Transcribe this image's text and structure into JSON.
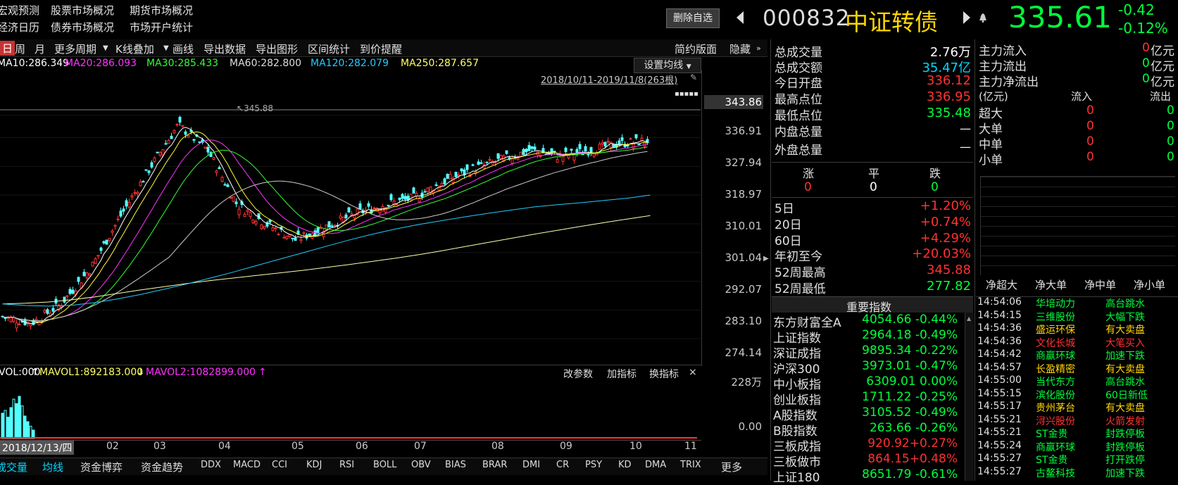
{
  "topnav": {
    "row1": [
      "宏观预测",
      "股票市场概况",
      "期货市场概况"
    ],
    "row2": [
      "经济日历",
      "债券市场概况",
      "市场开户统计"
    ]
  },
  "header": {
    "delete_button": "删除自选",
    "code": "000832",
    "name": "中证转债",
    "price": "335.61",
    "change": "-0.42",
    "change_pct": "-0.12%"
  },
  "toolbar": {
    "items": [
      "日",
      "周",
      "月",
      "更多周期",
      "K线叠加",
      "画线",
      "导出数据",
      "导出图形",
      "区间统计",
      "到价提醒"
    ],
    "simple_layout": "简约版面",
    "hide": "隐藏"
  },
  "ma_legend": {
    "ma10": "MA10:286.349",
    "ma20": "MA20:286.093",
    "ma30": "MA30:285.433",
    "ma60": "MA60:282.800",
    "ma120": "MA120:282.079",
    "ma250": "MA250:287.657",
    "set_ma": "设置均线",
    "date_range": "2018/10/11-2019/11/8(263根)"
  },
  "chart_data": {
    "type": "candlestick",
    "y_ticks": [
      "343.86",
      "336.91",
      "327.94",
      "318.97",
      "310.01",
      "301.04",
      "292.07",
      "283.10",
      "274.14"
    ],
    "ylim": [
      270,
      350
    ],
    "x_ticks": [
      "2018/12/13/四",
      "02",
      "03",
      "04",
      "05",
      "06",
      "07",
      "08",
      "09",
      "10",
      "11"
    ],
    "high_marker": "345.88",
    "volume_legend": {
      "vol": "VOL:000",
      "mavol1": "MAVOL1:892183.000",
      "mavol2": "MAVOL2:1082899.000"
    },
    "volume_y_ticks": [
      "228万",
      "0.00"
    ],
    "series": [
      {
        "name": "MA250",
        "values": [
          285,
          285.2,
          285.6,
          286.3,
          287.2,
          288.3,
          289.4,
          290.4,
          291.4,
          292.3,
          293.1,
          293.9,
          294.7,
          295.5,
          296.4,
          297.3,
          298.3,
          299.3,
          300.4,
          301.6,
          302.9,
          304.2,
          305.5,
          306.8,
          308.0,
          309.2,
          310.4,
          311.5,
          312.6
        ]
      },
      {
        "name": "MA120",
        "values": [
          285,
          284.5,
          284.3,
          284.6,
          285.4,
          286.6,
          288.0,
          289.6,
          291.3,
          293.1,
          295.0,
          297.0,
          299.0,
          301.0,
          303.0,
          305.0,
          306.8,
          308.4,
          309.8,
          311.0,
          312.2,
          313.3,
          314.3,
          315.3,
          316.0,
          316.6,
          317.3,
          318.0,
          319.0
        ]
      }
    ]
  },
  "vol_panel_buttons": [
    "改参数",
    "加指标",
    "换指标",
    "×"
  ],
  "bottom_tabs": [
    "成交量",
    "均线",
    "资金博弈",
    "资金趋势",
    "DDX",
    "MACD",
    "CCI",
    "KDJ",
    "RSI",
    "BOLL",
    "OBV",
    "BIAS",
    "BRAR",
    "DMI",
    "CR",
    "PSY",
    "KD",
    "DMA",
    "TRIX",
    "更多"
  ],
  "stats": {
    "total_volume": {
      "label": "总成交量",
      "value": "2.76万"
    },
    "total_amount": {
      "label": "总成交额",
      "value": "35.47亿"
    },
    "open": {
      "label": "今日开盘",
      "value": "336.12"
    },
    "high": {
      "label": "最高点位",
      "value": "336.95"
    },
    "low": {
      "label": "最低点位",
      "value": "335.48"
    },
    "inner": {
      "label": "内盘总量",
      "value": "—"
    },
    "outer": {
      "label": "外盘总量",
      "value": "—"
    },
    "updown_headers": [
      "涨",
      "平",
      "跌"
    ],
    "updown_values": [
      "0",
      "0",
      "0"
    ],
    "periods": [
      {
        "label": "5日",
        "value": "+1.20%"
      },
      {
        "label": "20日",
        "value": "+0.74%"
      },
      {
        "label": "60日",
        "value": "+4.29%"
      },
      {
        "label": "年初至今",
        "value": "+20.03%"
      },
      {
        "label": "52周最高",
        "value": "345.88"
      },
      {
        "label": "52周最低",
        "value": "277.82"
      }
    ]
  },
  "money_flow": {
    "inflow": {
      "label": "主力流入",
      "value": "0",
      "unit": "亿元"
    },
    "outflow": {
      "label": "主力流出",
      "value": "0",
      "unit": "亿元"
    },
    "net": {
      "label": "主力净流出",
      "value": "0",
      "unit": "亿元"
    },
    "table_headers": [
      "(亿元)",
      "流入",
      "流出"
    ],
    "rows": [
      {
        "label": "超大",
        "in": "0",
        "out": "0"
      },
      {
        "label": "大单",
        "in": "0",
        "out": "0"
      },
      {
        "label": "中单",
        "in": "0",
        "out": "0"
      },
      {
        "label": "小单",
        "in": "0",
        "out": "0"
      }
    ],
    "bar_labels": [
      "净超大",
      "净大单",
      "净中单",
      "净小单"
    ]
  },
  "indices": {
    "title": "重要指数",
    "rows": [
      {
        "name": "东方财富全A",
        "value": "4054.66 -0.44%",
        "color": "#00ff3c"
      },
      {
        "name": "上证指数",
        "value": "2964.18 -0.49%",
        "color": "#00ff3c"
      },
      {
        "name": "深证成指",
        "value": "9895.34 -0.22%",
        "color": "#00ff3c"
      },
      {
        "name": "沪深300",
        "value": "3973.01 -0.47%",
        "color": "#00ff3c"
      },
      {
        "name": "中小板指",
        "value": "6309.01  0.00%",
        "color": "#00ff3c"
      },
      {
        "name": "创业板指",
        "value": "1711.22 -0.25%",
        "color": "#00ff3c"
      },
      {
        "name": "A股指数",
        "value": "3105.52 -0.49%",
        "color": "#00ff3c"
      },
      {
        "name": "B股指数",
        "value": "263.66 -0.26%",
        "color": "#00ff3c"
      },
      {
        "name": "三板成指",
        "value": "920.92+0.27%",
        "color": "#ff3232"
      },
      {
        "name": "三板做市",
        "value": "864.15+0.48%",
        "color": "#ff3232"
      },
      {
        "name": "上证180",
        "value": "8651.79 -0.61%",
        "color": "#00ff3c"
      }
    ]
  },
  "ticker": [
    {
      "time": "14:54:06",
      "stock": "华培动力",
      "event": "高台跳水",
      "color": "#00ff3c"
    },
    {
      "time": "14:54:15",
      "stock": "三维股份",
      "event": "大幅下跌",
      "color": "#00ff3c"
    },
    {
      "time": "14:54:36",
      "stock": "盛运环保",
      "event": "有大卖盘",
      "color": "#ffd700"
    },
    {
      "time": "14:54:36",
      "stock": "文化长城",
      "event": "大笔买入",
      "color": "#ff3232"
    },
    {
      "time": "14:54:42",
      "stock": "商赢环球",
      "event": "加速下跌",
      "color": "#00ff3c"
    },
    {
      "time": "14:54:57",
      "stock": "长盈精密",
      "event": "有大卖盘",
      "color": "#ffd700"
    },
    {
      "time": "14:55:00",
      "stock": "当代东方",
      "event": "高台跳水",
      "color": "#00ff3c"
    },
    {
      "time": "14:55:15",
      "stock": "滨化股份",
      "event": "60日新低",
      "color": "#00ff3c"
    },
    {
      "time": "14:55:17",
      "stock": "贵州茅台",
      "event": "有大卖盘",
      "color": "#ffd700"
    },
    {
      "time": "14:55:21",
      "stock": "浔兴股份",
      "event": "火箭发射",
      "color": "#ff3232"
    },
    {
      "time": "14:55:21",
      "stock": "ST金贵",
      "event": "封跌停板",
      "color": "#00ff3c"
    },
    {
      "time": "14:55:24",
      "stock": "商赢环球",
      "event": "封跌停板",
      "color": "#00ff3c"
    },
    {
      "time": "14:55:27",
      "stock": "ST金贵",
      "event": "打开跌停",
      "color": "#00ff3c"
    },
    {
      "time": "14:55:27",
      "stock": "古鳌科技",
      "event": "加速下跌",
      "color": "#00ff3c"
    }
  ]
}
